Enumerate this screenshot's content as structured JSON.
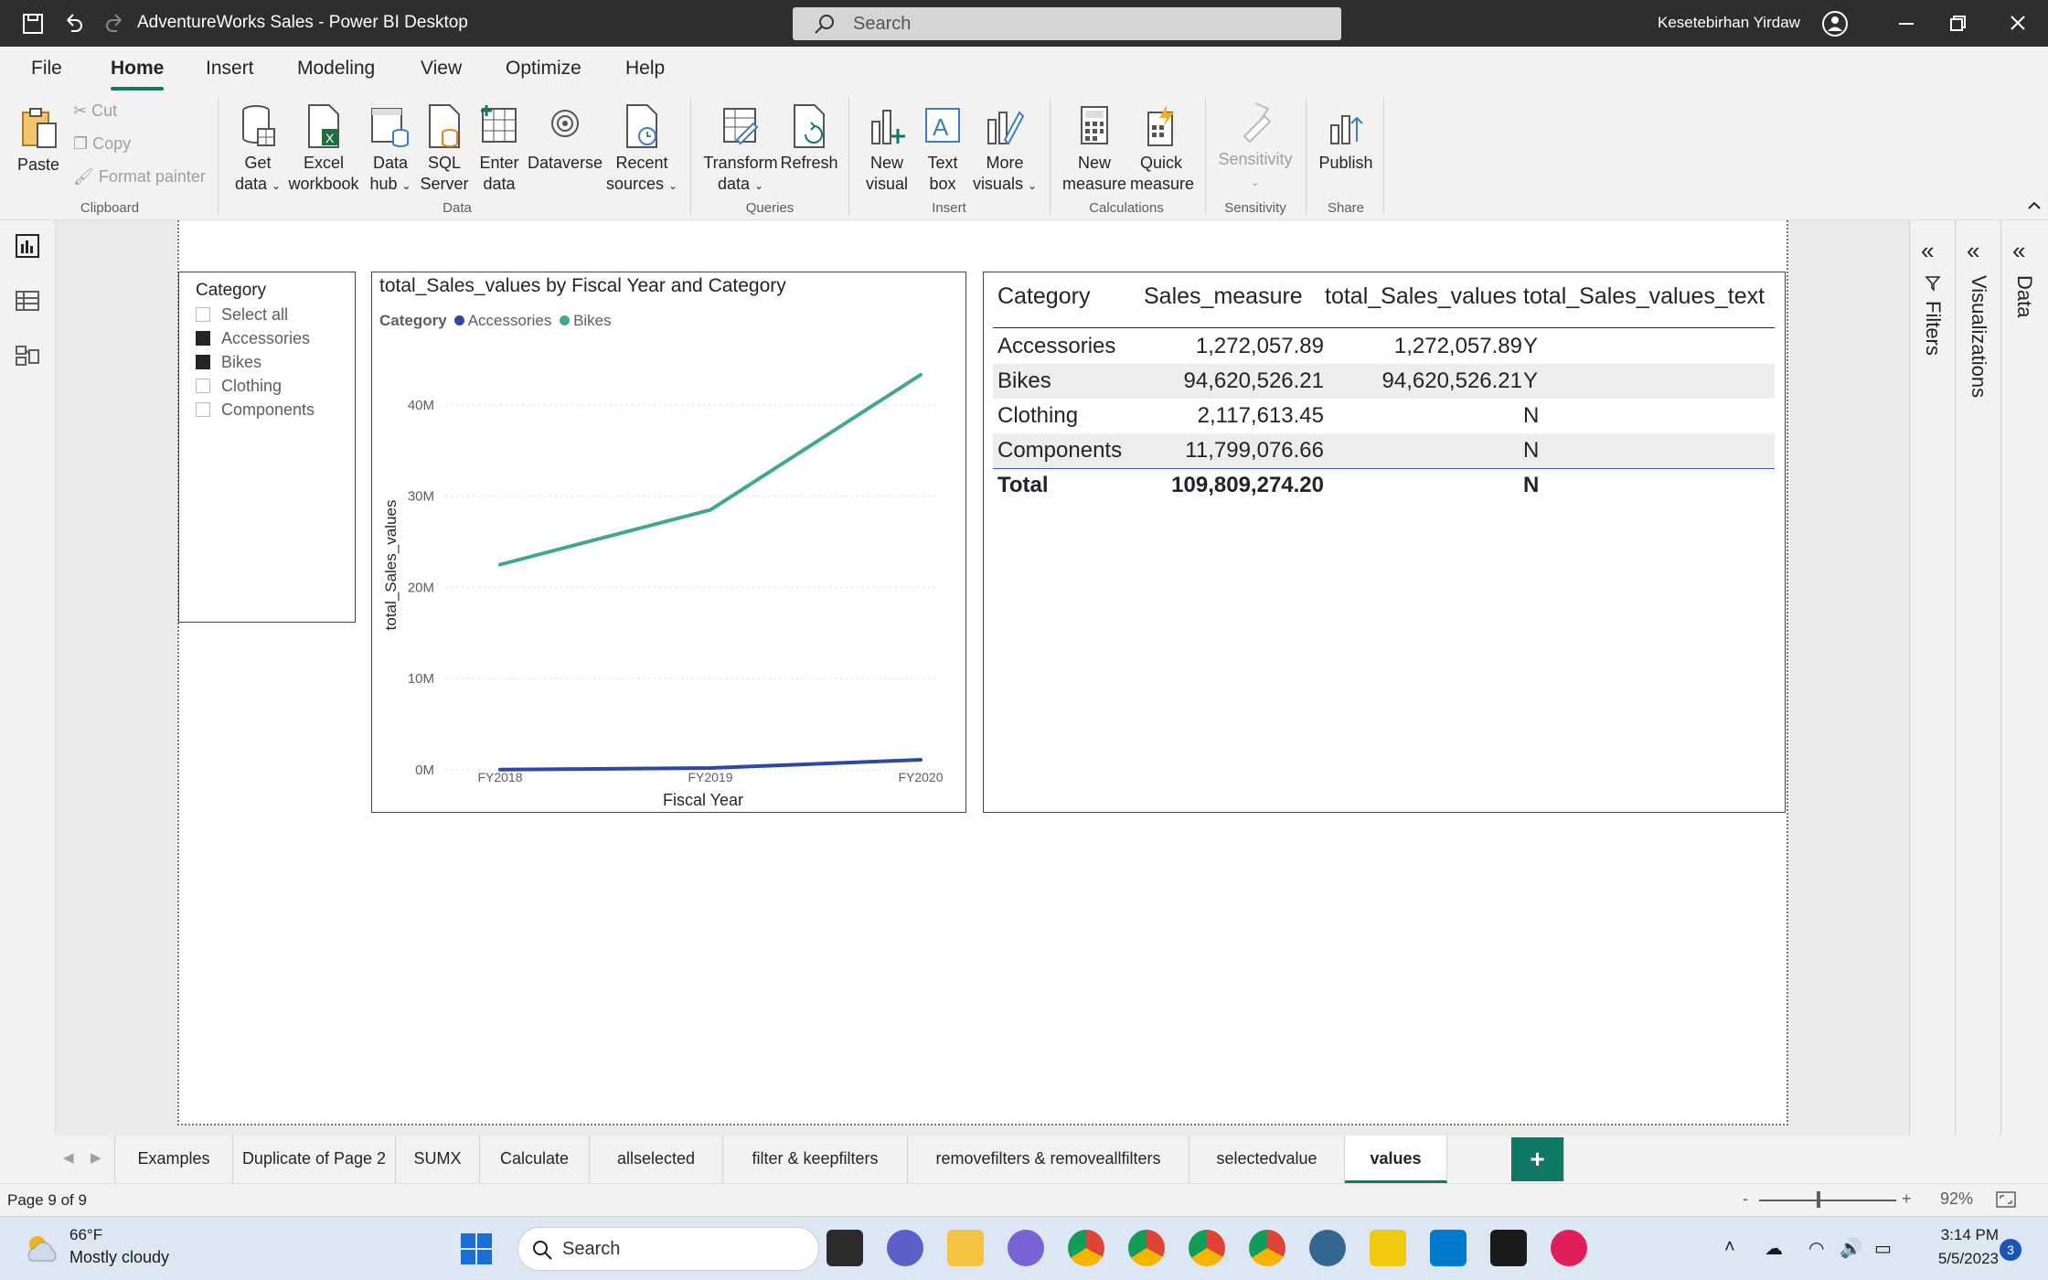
{
  "window": {
    "title": "AdventureWorks Sales - Power BI Desktop",
    "search_placeholder": "Search",
    "user_name": "Kesetebirhan Yirdaw"
  },
  "menu_tabs": [
    "File",
    "Home",
    "Insert",
    "Modeling",
    "View",
    "Optimize",
    "Help"
  ],
  "active_menu_tab": "Home",
  "ribbon": {
    "clipboard": {
      "paste": "Paste",
      "cut": "Cut",
      "copy": "Copy",
      "format_painter": "Format painter",
      "group": "Clipboard"
    },
    "data": {
      "get_data": [
        "Get",
        "data"
      ],
      "excel": [
        "Excel",
        "workbook"
      ],
      "data_hub": [
        "Data",
        "hub"
      ],
      "sql": [
        "SQL",
        "Server"
      ],
      "enter_data": [
        "Enter",
        "data"
      ],
      "dataverse": "Dataverse",
      "recent": [
        "Recent",
        "sources"
      ],
      "group": "Data"
    },
    "queries": {
      "transform": [
        "Transform",
        "data"
      ],
      "refresh": "Refresh",
      "group": "Queries"
    },
    "insert": {
      "new_visual": [
        "New",
        "visual"
      ],
      "text_box": [
        "Text",
        "box"
      ],
      "more_visuals": [
        "More",
        "visuals"
      ],
      "group": "Insert"
    },
    "calculations": {
      "new_measure": [
        "New",
        "measure"
      ],
      "quick_measure": [
        "Quick",
        "measure"
      ],
      "group": "Calculations"
    },
    "sensitivity": {
      "label": "Sensitivity",
      "group": "Sensitivity"
    },
    "share": {
      "publish": "Publish",
      "group": "Share"
    }
  },
  "slicer": {
    "header": "Category",
    "items": [
      {
        "label": "Select all",
        "state": "partial"
      },
      {
        "label": "Accessories",
        "state": "checked"
      },
      {
        "label": "Bikes",
        "state": "checked"
      },
      {
        "label": "Clothing",
        "state": "unchecked"
      },
      {
        "label": "Components",
        "state": "unchecked"
      }
    ]
  },
  "chart_data": {
    "type": "line",
    "title": "total_Sales_values by Fiscal Year and Category",
    "legend_title": "Category",
    "legend_placement": "top-left",
    "xlabel": "Fiscal Year",
    "ylabel": "total_Sales_values",
    "categories": [
      "FY2018",
      "FY2019",
      "FY2020"
    ],
    "y_ticks": [
      "0M",
      "10M",
      "20M",
      "30M",
      "40M"
    ],
    "ylim": [
      0,
      45000000
    ],
    "grid": true,
    "series": [
      {
        "name": "Accessories",
        "color": "#3049a0",
        "values": [
          20000,
          200000,
          1100000
        ]
      },
      {
        "name": "Bikes",
        "color": "#41a88e",
        "values": [
          22500000,
          28500000,
          43300000
        ]
      }
    ]
  },
  "table": {
    "columns": [
      "Category",
      "Sales_measure",
      "total_Sales_values",
      "total_Sales_values_text"
    ],
    "rows": [
      [
        "Accessories",
        "1,272,057.89",
        "1,272,057.89",
        "Y"
      ],
      [
        "Bikes",
        "94,620,526.21",
        "94,620,526.21",
        "Y"
      ],
      [
        "Clothing",
        "2,117,613.45",
        "",
        "N"
      ],
      [
        "Components",
        "11,799,076.66",
        "",
        "N"
      ]
    ],
    "total": [
      "Total",
      "109,809,274.20",
      "",
      "N"
    ]
  },
  "panes": {
    "filters": "Filters",
    "visualizations": "Visualizations",
    "data": "Data"
  },
  "page_tabs": [
    "Examples",
    "Duplicate of Page 2",
    "SUMX",
    "Calculate",
    "allselected",
    "filter & keepfilters",
    "removefilters & removeallfilters",
    "selectedvalue",
    "values"
  ],
  "active_page_tab": "values",
  "status": {
    "page": "Page 9 of 9",
    "zoom": "92%"
  },
  "taskbar": {
    "weather_temp": "66°F",
    "weather_desc": "Mostly cloudy",
    "search": "Search",
    "time": "3:14 PM",
    "date": "5/5/2023",
    "notification_count": "3"
  }
}
